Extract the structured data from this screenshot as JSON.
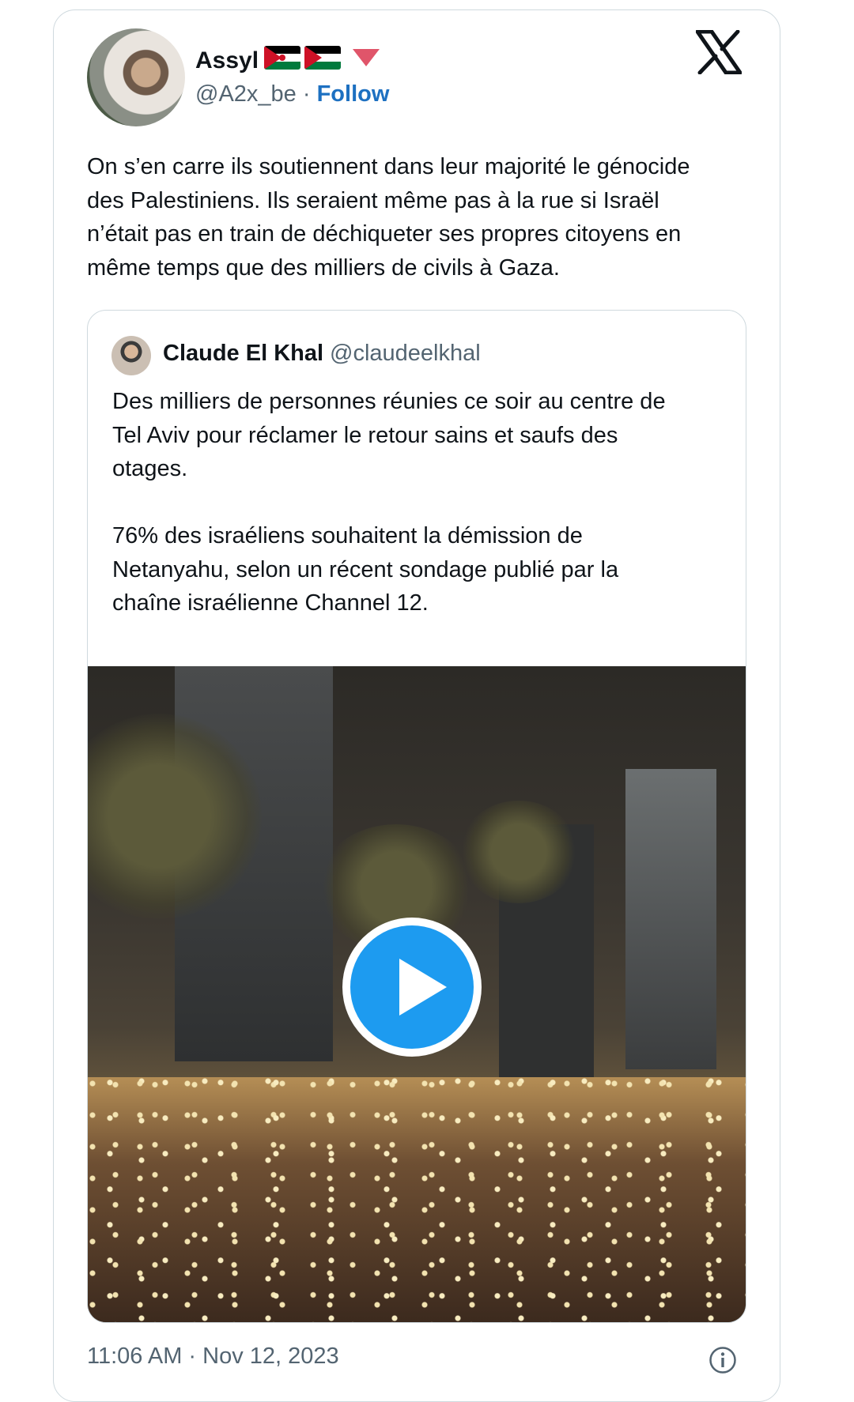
{
  "author": {
    "display_name": "Assyl",
    "handle": "@A2x_be",
    "separator": "·",
    "follow_label": "Follow"
  },
  "tweet": {
    "text": "On s’en carre ils soutiennent dans leur majorité le génocide\ndes Palestiniens. Ils seraient même pas à la rue si Israël\nn’était pas en train de déchiqueter ses propres citoyens en\nmême temps que des milliers de civils à Gaza."
  },
  "quoted_tweet": {
    "display_name": "Claude El Khal",
    "handle": "@claudeelkhal",
    "text": "Des milliers de personnes réunies ce soir au centre de\nTel Aviv pour réclamer le retour sains et saufs des\notages.\n\n76% des israéliens souhaitent la démission de\nNetanyahu, selon un récent sondage publié par la\nchaîne israélienne Channel 12."
  },
  "meta": {
    "timestamp": "11:06 AM · Nov 12, 2023"
  },
  "icons": {
    "brand": "x-logo-icon",
    "flag_1": "western-sahara-flag-icon",
    "flag_2": "palestine-flag-icon",
    "emoji": "red-heart-icon",
    "play": "play-icon",
    "info": "info-icon"
  },
  "colors": {
    "follow_link": "#1d70c1",
    "secondary_text": "#536471",
    "play_button": "#1d9bf0",
    "border": "#cfd9de"
  }
}
